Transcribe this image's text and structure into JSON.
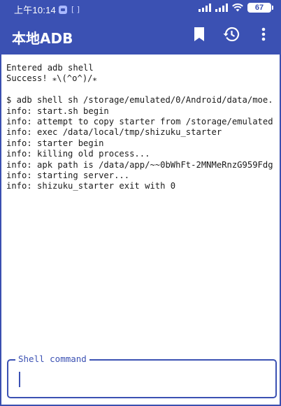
{
  "status_bar": {
    "time": "上午10:14",
    "battery": "67"
  },
  "app_bar": {
    "title": "本地ADB",
    "icons": [
      "bookmark-icon",
      "history-icon",
      "more-vert-icon"
    ]
  },
  "terminal": {
    "lines": [
      "Entered adb shell",
      "Success! ⁎\\(^o^)/⁎",
      "",
      "$ adb shell sh /storage/emulated/0/Android/data/moe.",
      "info: start.sh begin",
      "info: attempt to copy starter from /storage/emulated",
      "info: exec /data/local/tmp/shizuku_starter",
      "info: starter begin",
      "info: killing old process...",
      "info: apk path is /data/app/~~0bWhFt-2MNMeRnzG959Fdg",
      "info: starting server...",
      "info: shizuku_starter exit with 0"
    ]
  },
  "shell_command": {
    "label": "Shell command",
    "value": ""
  },
  "colors": {
    "primary": "#3b51b3",
    "background": "#ffffff",
    "text": "#1a1a1a"
  }
}
